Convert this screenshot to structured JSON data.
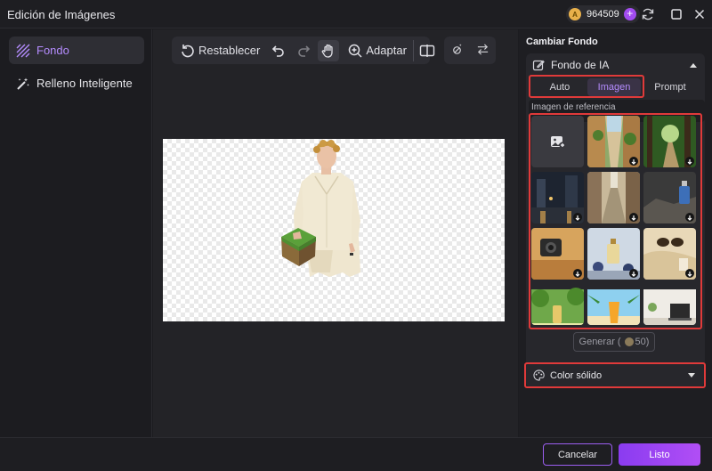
{
  "window": {
    "title": "Edición de Imágenes",
    "credits": {
      "coin_letter": "A",
      "amount": "964509",
      "plus": "+"
    },
    "controls": [
      "refresh-icon",
      "maximize-icon",
      "close-icon"
    ]
  },
  "sidebar": {
    "items": [
      {
        "label": "Fondo",
        "icon": "background-icon",
        "active": true
      },
      {
        "label": "Relleno Inteligente",
        "icon": "magic-wand-icon",
        "active": false
      }
    ]
  },
  "toolbar": {
    "reset_label": "Restablecer",
    "fit_label": "Adaptar",
    "tools": [
      "reset-icon",
      "undo-icon",
      "redo-icon",
      "hand-icon",
      "zoom-fit-icon",
      "compare-icon"
    ],
    "secondary_tools": [
      "magic-erase-icon",
      "swap-icon"
    ]
  },
  "panel": {
    "heading": "Cambiar Fondo",
    "ai_background": {
      "label": "Fondo de IA",
      "expanded": true,
      "tabs": [
        {
          "label": "Auto",
          "active": false
        },
        {
          "label": "Imagen",
          "active": true
        },
        {
          "label": "Prompt",
          "active": false
        }
      ],
      "reference_label": "Imagen de referencia",
      "thumbnails": [
        "upload-reference-icon",
        "old-town-street",
        "forest-path",
        "rainy-city-street",
        "narrow-alley",
        "perfume-bottle-on-rocks",
        "camera-on-sand",
        "perfume-with-flowers",
        "sunglasses-on-fabric",
        "bottle-in-garden",
        "drink-on-beach",
        "laptop-on-desk"
      ],
      "generate_label": "Generar",
      "generate_cost": "50"
    },
    "solid_color": {
      "label": "Color sólido",
      "expanded": false
    }
  },
  "footer": {
    "cancel_label": "Cancelar",
    "done_label": "Listo"
  },
  "colors": {
    "accent": "#a24cf0",
    "highlight": "#e03a3a",
    "background": "#1c1c20"
  }
}
